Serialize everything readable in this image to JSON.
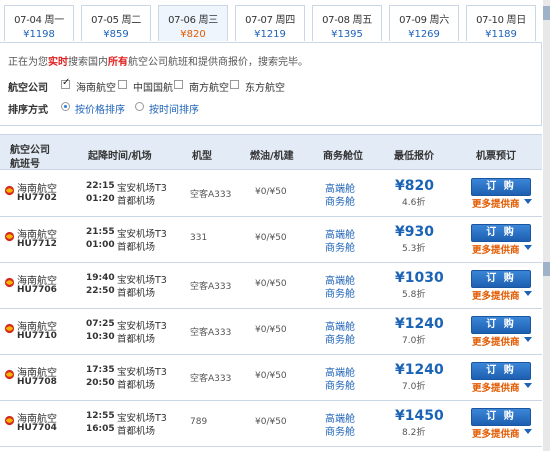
{
  "date_tabs": [
    {
      "date": "07-04 周一",
      "price": "¥1198"
    },
    {
      "date": "07-05 周二",
      "price": "¥859"
    },
    {
      "date": "07-06 周三",
      "price": "¥820"
    },
    {
      "date": "07-07 周四",
      "price": "¥1219"
    },
    {
      "date": "07-08 周五",
      "price": "¥1395"
    },
    {
      "date": "07-09 周六",
      "price": "¥1269"
    },
    {
      "date": "07-10 周日",
      "price": "¥1189"
    }
  ],
  "notice": {
    "pre": "正在为您",
    "hl1": "实时",
    "mid": "搜索国内",
    "hl2": "所有",
    "post": "航空公司航班和提供商报价，搜索完毕。"
  },
  "filters": {
    "airline_label": "航空公司",
    "airlines": [
      {
        "label": "海南航空",
        "checked": true
      },
      {
        "label": "中国国航",
        "checked": false
      },
      {
        "label": "南方航空",
        "checked": false
      },
      {
        "label": "东方航空",
        "checked": false
      }
    ],
    "sort_label": "排序方式",
    "sort_options": [
      {
        "label": "按价格排序",
        "selected": true
      },
      {
        "label": "按时间排序",
        "selected": false
      }
    ]
  },
  "table": {
    "headers": {
      "airline_l1": "航空公司",
      "airline_l2": "航班号",
      "time": "起降时间/机场",
      "plane": "机型",
      "fuel": "燃油/机建",
      "cabin": "商务舱位",
      "price": "最低报价",
      "book": "机票预订"
    },
    "rows": [
      {
        "airline": "海南航空",
        "flight": "HU7702",
        "dep_time": "22:15",
        "arr_time": "01:20",
        "dep_airport": "宝安机场T3",
        "arr_airport": "首都机场",
        "plane": "空客A333",
        "fuel": "¥0/¥50",
        "cabin1": "高端舱",
        "cabin2": "商务舱",
        "price": "¥820",
        "discount": "4.6折",
        "book": "订 购",
        "more": "更多提供商"
      },
      {
        "airline": "海南航空",
        "flight": "HU7712",
        "dep_time": "21:55",
        "arr_time": "01:00",
        "dep_airport": "宝安机场T3",
        "arr_airport": "首都机场",
        "plane": "331",
        "fuel": "¥0/¥50",
        "cabin1": "高端舱",
        "cabin2": "商务舱",
        "price": "¥930",
        "discount": "5.3折",
        "book": "订 购",
        "more": "更多提供商"
      },
      {
        "airline": "海南航空",
        "flight": "HU7706",
        "dep_time": "19:40",
        "arr_time": "22:50",
        "dep_airport": "宝安机场T3",
        "arr_airport": "首都机场",
        "plane": "空客A333",
        "fuel": "¥0/¥50",
        "cabin1": "高端舱",
        "cabin2": "商务舱",
        "price": "¥1030",
        "discount": "5.8折",
        "book": "订 购",
        "more": "更多提供商"
      },
      {
        "airline": "海南航空",
        "flight": "HU7710",
        "dep_time": "07:25",
        "arr_time": "10:30",
        "dep_airport": "宝安机场T3",
        "arr_airport": "首都机场",
        "plane": "空客A333",
        "fuel": "¥0/¥50",
        "cabin1": "高端舱",
        "cabin2": "商务舱",
        "price": "¥1240",
        "discount": "7.0折",
        "book": "订 购",
        "more": "更多提供商"
      },
      {
        "airline": "海南航空",
        "flight": "HU7708",
        "dep_time": "17:35",
        "arr_time": "20:50",
        "dep_airport": "宝安机场T3",
        "arr_airport": "首都机场",
        "plane": "空客A333",
        "fuel": "¥0/¥50",
        "cabin1": "高端舱",
        "cabin2": "商务舱",
        "price": "¥1240",
        "discount": "7.0折",
        "book": "订 购",
        "more": "更多提供商"
      },
      {
        "airline": "海南航空",
        "flight": "HU7704",
        "dep_time": "12:55",
        "arr_time": "16:05",
        "dep_airport": "宝安机场T3",
        "arr_airport": "首都机场",
        "plane": "789",
        "fuel": "¥0/¥50",
        "cabin1": "高端舱",
        "cabin2": "商务舱",
        "price": "¥1450",
        "discount": "8.2折",
        "book": "订 购",
        "more": "更多提供商"
      }
    ]
  },
  "colors": {
    "accent": "#1d62b8",
    "price": "#1a63b5",
    "highlight": "#e35a00",
    "header_bg": "#e3ecf6",
    "border": "#c9d7e6"
  }
}
